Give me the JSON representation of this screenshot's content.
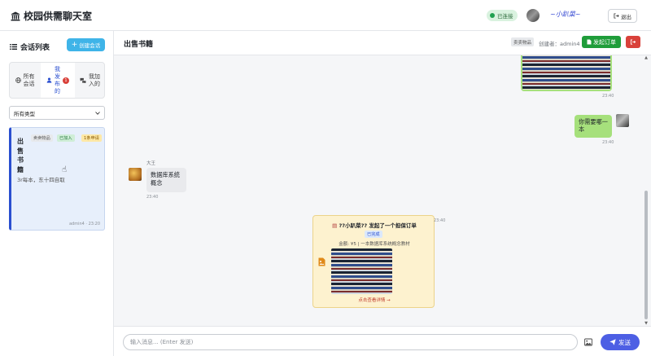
{
  "header": {
    "app_title": "校园供需聊天室",
    "status": "已连接",
    "username": "~小趴菜~",
    "logout_label": "退出"
  },
  "sidebar": {
    "title": "会话列表",
    "new_session_label": "创建会话",
    "tabs": [
      {
        "label": "所有会话"
      },
      {
        "label": "我发布的",
        "badge": "1"
      },
      {
        "label": "我加入的"
      }
    ],
    "type_select": {
      "value": "所有类型"
    },
    "sessions": [
      {
        "title": "出售书籍",
        "tags": [
          "卖卖物品",
          "已加入",
          "1条申请"
        ],
        "description": "3r每本，东十四自取",
        "meta": "admin4 · 23:20"
      }
    ]
  },
  "chat": {
    "title": "出售书籍",
    "type_tag": "卖卖物品",
    "creator": "创建者：admin4",
    "order_button_label": "发起订单",
    "messages": [
      {
        "side": "right",
        "kind": "image",
        "time": "23:40"
      },
      {
        "side": "right",
        "kind": "text",
        "text": "你需要哪一本",
        "time": "23:40"
      },
      {
        "side": "left",
        "kind": "text",
        "sender": "大王",
        "text": "数据库系统概念",
        "time": "23:40"
      },
      {
        "side": "center",
        "kind": "order",
        "title": "??小趴菜?? 发起了一个担保订单",
        "status": "已完成",
        "info": "金额: ¥5 | 一本数据库系统概念教材",
        "link": "点击查看详情 →",
        "time": "23:40"
      }
    ]
  },
  "composer": {
    "placeholder": "输入消息... (Enter 发送)",
    "send_label": "发送"
  },
  "colors": {
    "accent": "#4d5fe4",
    "own_bubble": "#a6e07c",
    "order_card": "#fdf2cf",
    "danger": "#d9413a",
    "success": "#1f9d3a"
  }
}
